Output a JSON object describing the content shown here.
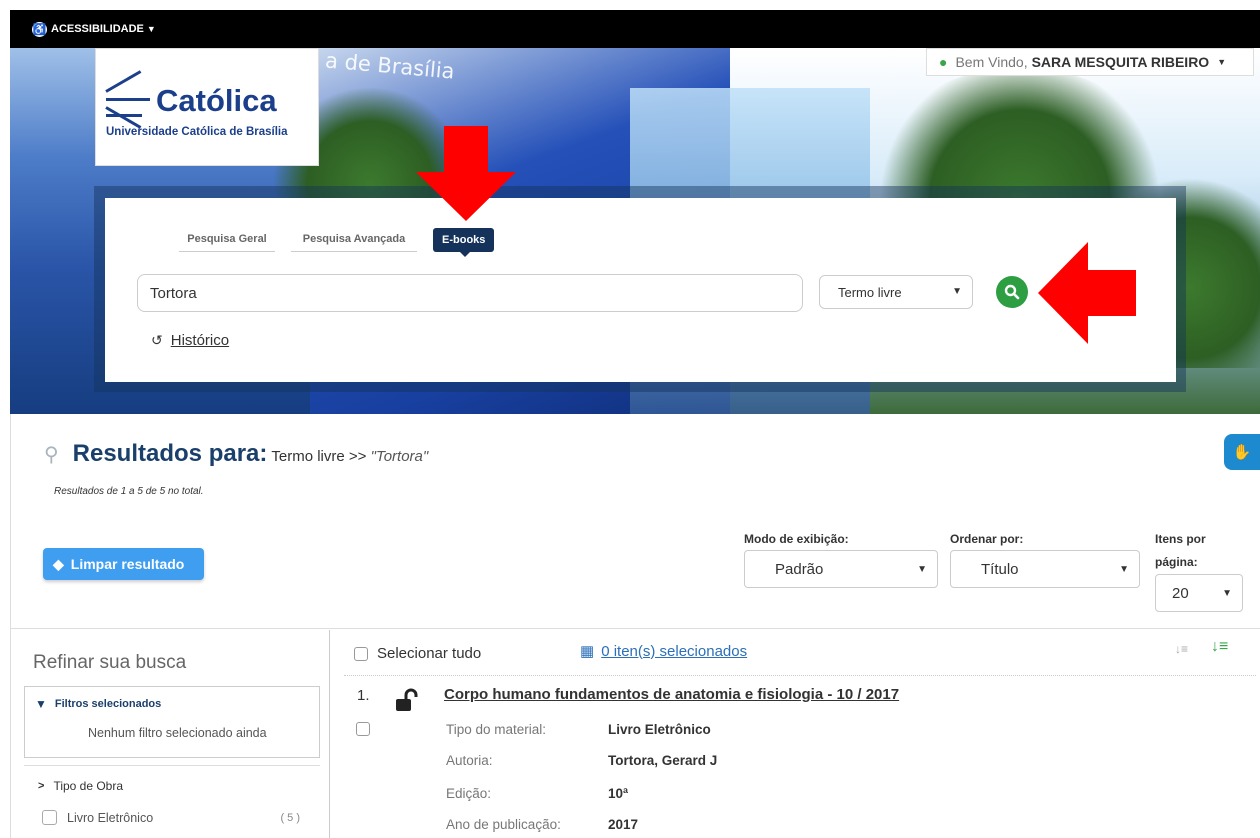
{
  "accessibility": {
    "label": "ACESSIBILIDADE"
  },
  "header": {
    "logo_word": "Católica",
    "logo_sub": "Universidade Católica de Brasília",
    "sign_text": "a de Brasília",
    "welcome_prefix": "Bem Vindo,",
    "user_name": "SARA MESQUITA RIBEIRO"
  },
  "search": {
    "tabs": [
      {
        "label": "Pesquisa Geral"
      },
      {
        "label": "Pesquisa Avançada"
      },
      {
        "label": "E-books"
      }
    ],
    "query": "Tortora",
    "field_select": "Termo livre",
    "history_label": "Histórico"
  },
  "results": {
    "title": "Resultados para:",
    "term_prefix": "Termo livre >>",
    "term": "\"Tortora\"",
    "count_text": "Resultados de 1 a 5 de 5 no total.",
    "clear_label": "Limpar resultado",
    "display_mode_label": "Modo de exibição:",
    "display_mode_value": "Padrão",
    "sort_label": "Ordenar por:",
    "sort_value": "Título",
    "per_page_label_1": "Itens por",
    "per_page_label_2": "página:",
    "per_page_value": "20",
    "select_all_label": "Selecionar tudo",
    "selected_label": "0 iten(s) selecionados"
  },
  "sidebar": {
    "refine_title": "Refinar sua busca",
    "filters_title": "Filtros selecionados",
    "no_filters": "Nenhum filtro selecionado ainda",
    "facet_title": "Tipo de Obra",
    "facets": [
      {
        "label": "Livro Eletrônico",
        "count": "( 5 )"
      }
    ]
  },
  "items": [
    {
      "number": "1.",
      "title": "Corpo humano fundamentos de anatomia e fisiologia - 10 / 2017",
      "fields": [
        {
          "key": "Tipo do material:",
          "value": "Livro Eletrônico"
        },
        {
          "key": "Autoria:",
          "value": "Tortora, Gerard J"
        },
        {
          "key": "Edição:",
          "value": "10ª"
        },
        {
          "key": "Ano de publicação:",
          "value": "2017"
        }
      ]
    }
  ],
  "colors": {
    "search_button": "#2e9e43",
    "active_tab": "#14325a",
    "clear_button": "#3f9ef0",
    "annotation_arrow": "#ff0000",
    "brand": "#1b3f8b"
  }
}
